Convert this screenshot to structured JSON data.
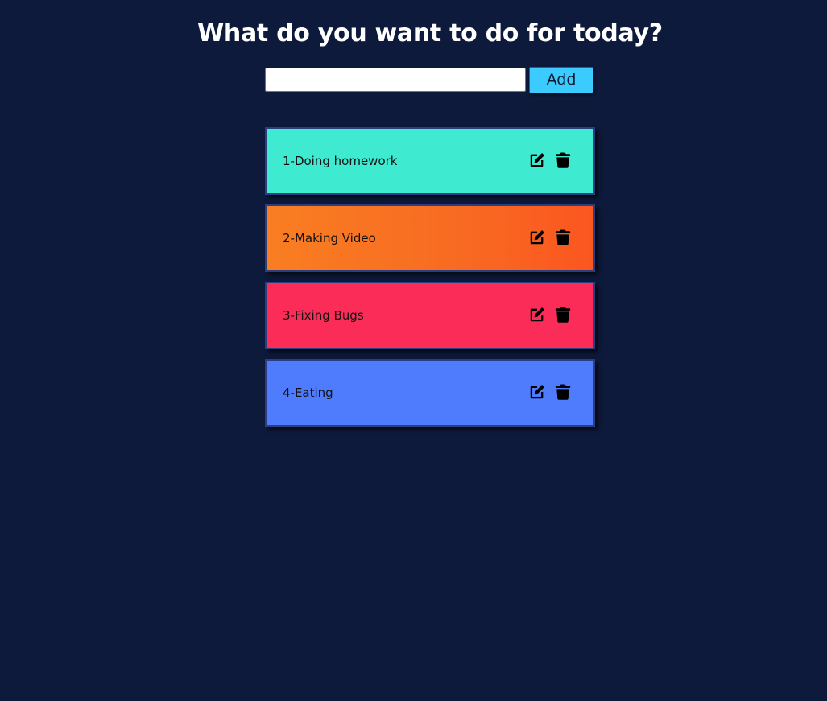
{
  "header": {
    "title": "What do you want to do for today?"
  },
  "form": {
    "input_value": "",
    "input_placeholder": "",
    "add_label": "Add",
    "add_color": "#3ccbff"
  },
  "colors": {
    "background": "#0e1a3c",
    "item_1": "#3eead0",
    "item_2": "#f97e22",
    "item_3": "#fb2c57",
    "item_4": "#4e7cfc"
  },
  "todos": [
    {
      "text": "1-Doing homework",
      "icons": [
        "edit-icon",
        "trash-icon"
      ]
    },
    {
      "text": "2-Making Video",
      "icons": [
        "edit-icon",
        "trash-icon"
      ]
    },
    {
      "text": "3-Fixing Bugs",
      "icons": [
        "edit-icon",
        "trash-icon"
      ]
    },
    {
      "text": "4-Eating",
      "icons": [
        "edit-icon",
        "trash-icon"
      ]
    }
  ]
}
